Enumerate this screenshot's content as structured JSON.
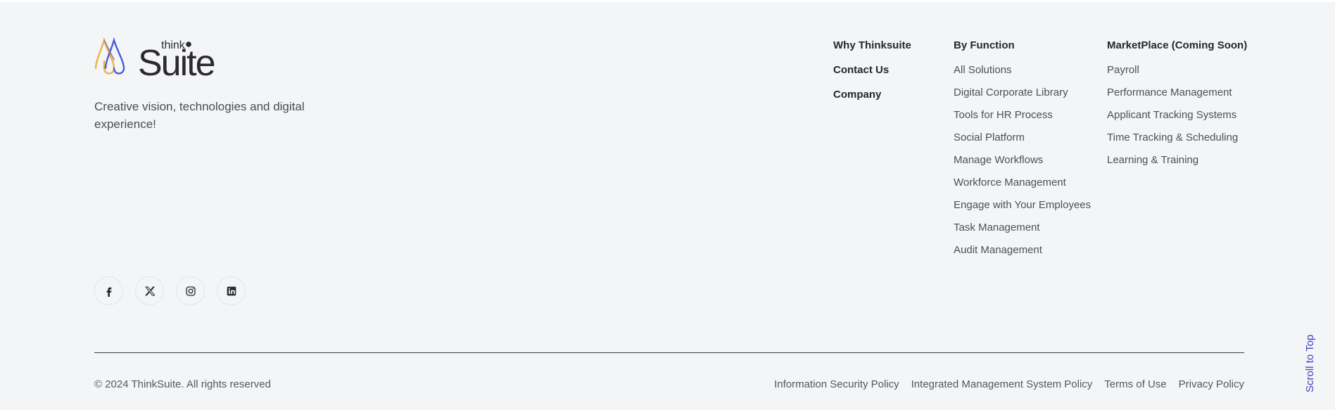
{
  "brand": {
    "logo_small": "think",
    "logo_large": "Suite",
    "tagline": "Creative vision, technologies and digital experience!"
  },
  "colors": {
    "background": "#f4f5f7",
    "accent_blue": "#3f3fc4",
    "logo_gold": "#e8b44a",
    "logo_blue": "#4a5bd6"
  },
  "social": [
    {
      "name": "facebook-icon"
    },
    {
      "name": "x-twitter-icon"
    },
    {
      "name": "instagram-icon"
    },
    {
      "name": "linkedin-icon"
    }
  ],
  "nav": {
    "primary": [
      "Why Thinksuite",
      "Contact Us",
      "Company"
    ],
    "by_function": {
      "title": "By Function",
      "items": [
        "All Solutions",
        "Digital Corporate Library",
        "Tools for HR Process",
        "Social Platform",
        "Manage Workflows",
        "Workforce Management",
        "Engage with Your Employees",
        "Task Management",
        "Audit Management"
      ]
    },
    "marketplace": {
      "title": "MarketPlace (Coming Soon)",
      "items": [
        "Payroll",
        "Performance Management",
        "Applicant Tracking Systems",
        "Time Tracking & Scheduling",
        "Learning & Training"
      ]
    }
  },
  "bottom": {
    "copyright": "© 2024 ThinkSuite. All rights reserved",
    "links": [
      "Information Security Policy",
      "Integrated Management System Policy",
      "Terms of Use",
      "Privacy Policy"
    ]
  },
  "scroll_top": "Scroll to Top"
}
